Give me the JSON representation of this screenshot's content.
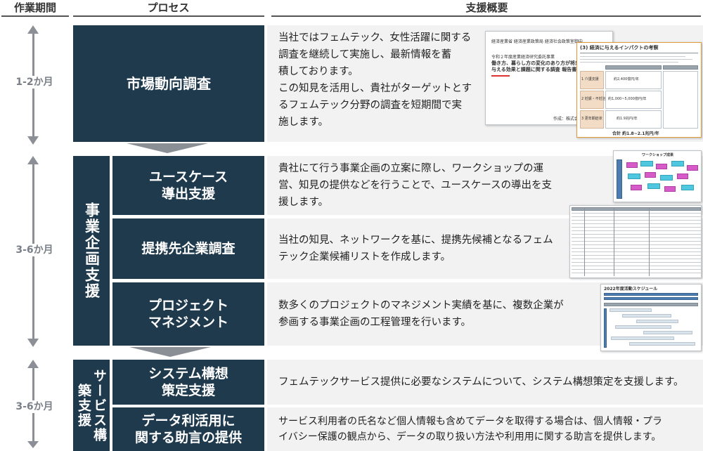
{
  "headers": {
    "period": "作業期間",
    "process": "プロセス",
    "overview": "支援概要"
  },
  "periods": [
    "1-2か月",
    "3-6か月",
    "3-6か月"
  ],
  "groups": {
    "business_planning": "事業企画支援",
    "service_building": "サービス構築支援"
  },
  "processes": [
    {
      "label": "市場動向調査",
      "desc": "当社ではフェムテック、女性活躍に関する\n調査を継続して実施し、最新情報を蓄\n積しております。\nこの知見を活用し、貴社がターゲットとす\nるフェムテック分野の調査を短期間で実\n施します。"
    },
    {
      "label": "ユースケース\n導出支援",
      "desc": "貴社にて行う事業企画の立案に際し、ワークショップの運\n営、知見の提供などを行うことで、ユースケースの導出を支\n援します。"
    },
    {
      "label": "提携先企業調査",
      "desc": "当社の知見、ネットワークを基に、提携先候補となるフェム\nテック企業候補リストを作成します。"
    },
    {
      "label": "プロジェクト\nマネジメント",
      "desc": "数多くのプロジェクトのマネジメント実績を基に、複数企業が\n参画する事業企画の工程管理を行います。"
    },
    {
      "label": "システム構想\n策定支援",
      "desc": "フェムテックサービス提供に必要なシステムについて、システム構想策定を支援します。"
    },
    {
      "label": "データ利活用に\n関する助言の提供",
      "desc": "サービス利用者の氏名など個人情報も含めてデータを取得する場合は、個人情報・プラ\nイバシー保護の観点から、データの取り扱い方法や利用用に関する助言を提供します。"
    }
  ],
  "thumbnails": {
    "report": {
      "line1": "経済産業省 経済産業政策局 経済社会政策室御中",
      "line2": "令和２年度産業経済研究委託事業",
      "line3": "働き方、暮らし方の変化のあり方が将来の日",
      "line4": "与える効果と課題に関する調査 報告書（概",
      "footer": "作成：株式会社 日",
      "panel_title": "(3) 経済に与えるインパクトの考察",
      "panel_total": "合計 約1.8~2.1兆円/年",
      "panel_rows": [
        "1 介護支援",
        "2 妊娠・不妊治療",
        "3 更年期症状"
      ],
      "panel_values": [
        "約2,400億円/年",
        "約1,000~5,000億円/年",
        "約1.9兆円/年"
      ]
    },
    "workshop": {
      "title": "ワークショップ成果"
    },
    "schedule": {
      "title": "2022年度活動スケジュール"
    }
  },
  "colors": {
    "box": "#1f3a4d",
    "desc_bg": "#f2f2f2",
    "chevron": "#8a8f95",
    "arrow": "#8c9096"
  }
}
